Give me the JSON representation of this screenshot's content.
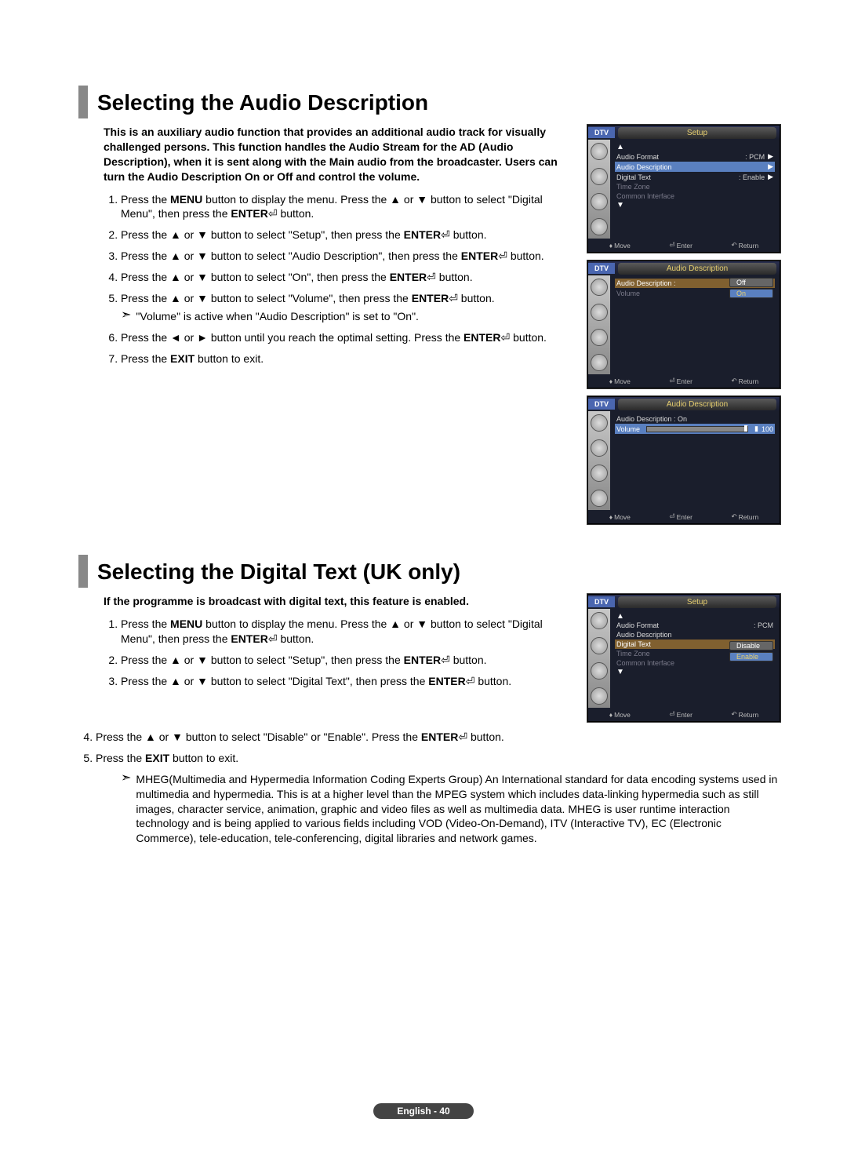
{
  "section1": {
    "title": "Selecting the Audio Description",
    "intro": "This is an auxiliary audio function that provides an additional audio track for visually challenged persons. This function handles the Audio Stream for the AD (Audio Description), when it is sent along with the Main audio from the broadcaster. Users can turn the Audio Description On or Off and control the volume.",
    "steps": {
      "s1a": "Press the ",
      "s1b": " button to display the menu. Press the ▲ or ▼ button to select \"Digital Menu\", then press the ",
      "s1c": " button.",
      "s2a": "Press the ▲ or ▼ button to select \"Setup\", then press the ",
      "s2b": " button.",
      "s3a": "Press the ▲ or ▼ button to select \"Audio Description\", then press the ",
      "s3b": " button.",
      "s4a": "Press the ▲ or ▼ button to select \"On\", then press the ",
      "s4b": " button.",
      "s5a": "Press the ▲ or ▼ button to select \"Volume\", then press the ",
      "s5b": " button.",
      "s5note": "\"Volume\" is active when \"Audio Description\" is set to \"On\".",
      "s6a": "Press the ◄ or ► button until you reach the optimal setting. Press the ",
      "s6b": " button.",
      "s7a": "Press the ",
      "s7b": " button to exit."
    },
    "kw": {
      "menu": "MENU",
      "enter": "ENTER",
      "exit": "EXIT"
    },
    "enter_glyph": "⏎"
  },
  "section2": {
    "title": "Selecting the Digital Text (UK only)",
    "intro": "If the programme is broadcast with digital text, this feature is enabled.",
    "steps": {
      "s1a": "Press the ",
      "s1b": " button to display the menu. Press the ▲ or ▼ button to select \"Digital Menu\", then press the ",
      "s1c": " button.",
      "s2a": "Press the ▲ or ▼ button to select \"Setup\", then press the ",
      "s2b": " button.",
      "s3a": "Press the ▲ or ▼ button to select \"Digital Text\", then press the ",
      "s3b": " button.",
      "s4a": "Press the ▲ or ▼ button to select \"Disable\" or \"Enable\". Press the ",
      "s4b": " button.",
      "s5a": "Press the ",
      "s5b": " button to exit."
    },
    "mheg": "MHEG(Multimedia and Hypermedia Information Coding Experts Group) An International standard for data encoding systems used in multimedia and hypermedia. This is at a higher level than the MPEG system which includes data-linking hypermedia such as still images, character service, animation, graphic and video files as well as multimedia data. MHEG is user runtime interaction technology and is being applied to various fields including VOD (Video-On-Demand), ITV (Interactive TV), EC (Electronic Commerce), tele-education, tele-conferencing, digital libraries and network games."
  },
  "osd": {
    "dtv": "DTV",
    "setup": "Setup",
    "audio_desc": "Audio Description",
    "audio_format": "Audio Format",
    "pcm": ": PCM",
    "digital_text": "Digital Text",
    "enable": ": Enable",
    "time_zone": "Time Zone",
    "common_if": "Common Interface",
    "ad_label": "Audio Description :",
    "ad_on": "Audio Description : On",
    "volume": "Volume",
    "off": "Off",
    "on": "On",
    "disable": "Disable",
    "enable2": "Enable",
    "v100": "100",
    "move": "Move",
    "enter": "Enter",
    "return": "Return"
  },
  "footer": "English - 40"
}
